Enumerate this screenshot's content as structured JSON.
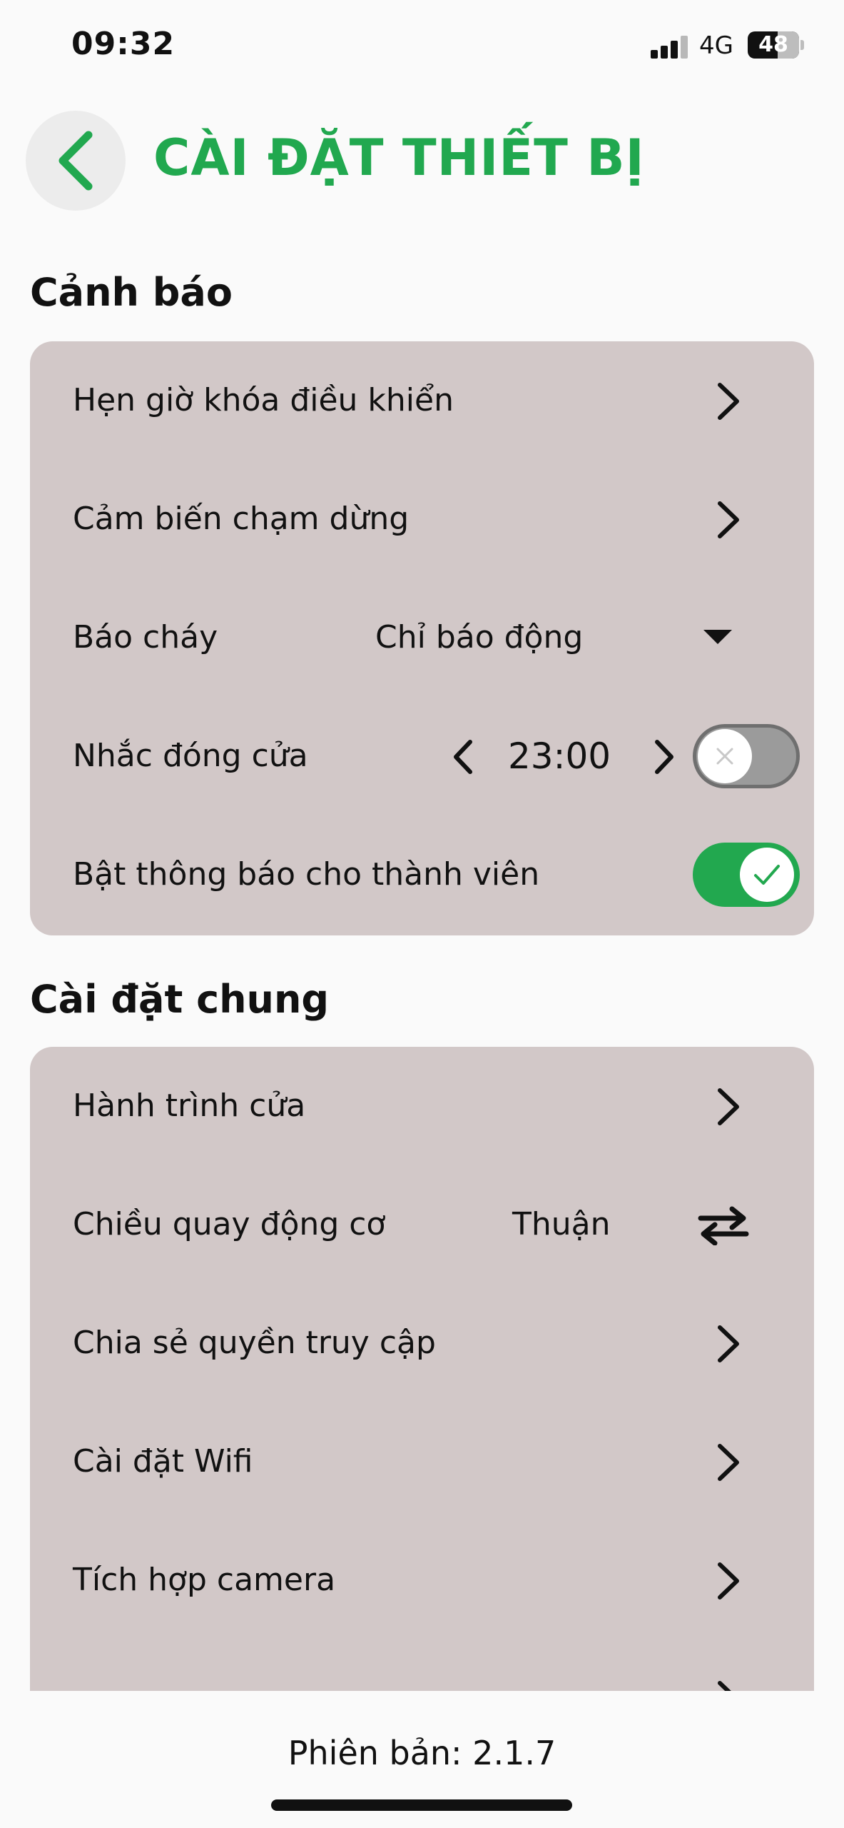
{
  "status_bar": {
    "time": "09:32",
    "network": "4G",
    "battery": "48"
  },
  "header": {
    "back_icon": "chevron-left-icon",
    "title": "CÀI ĐẶT THIẾT BỊ",
    "accent_color": "#21a84f"
  },
  "alerts": {
    "title": "Cảnh báo",
    "items": [
      {
        "label": "Hẹn giờ khóa điều khiển",
        "icon": "chevron-right-icon"
      },
      {
        "label": "Cảm biến chạm dừng",
        "icon": "chevron-right-icon"
      },
      {
        "label": "Báo cháy",
        "value": "Chỉ báo động",
        "icon": "caret-down-icon"
      },
      {
        "label": "Nhắc đóng cửa",
        "value": "23:00",
        "toggle_on": false
      },
      {
        "label": "Bật thông báo cho thành viên",
        "toggle_on": true
      }
    ]
  },
  "general": {
    "title": "Cài đặt chung",
    "items": [
      {
        "label": "Hành trình cửa",
        "icon": "chevron-right-icon"
      },
      {
        "label": "Chiều quay động cơ",
        "value": "Thuận",
        "icon": "swap-arrows-icon"
      },
      {
        "label": "Chia sẻ quyền truy cập",
        "icon": "chevron-right-icon"
      },
      {
        "label": "Cài đặt Wifi",
        "icon": "chevron-right-icon"
      },
      {
        "label": "Tích hợp camera",
        "icon": "chevron-right-icon"
      }
    ]
  },
  "footer": {
    "version": "Phiên bản: 2.1.7"
  },
  "colors": {
    "card_bg": "#d2c8c8",
    "toggle_on": "#22a84f",
    "toggle_off": "#9b9b9b"
  }
}
